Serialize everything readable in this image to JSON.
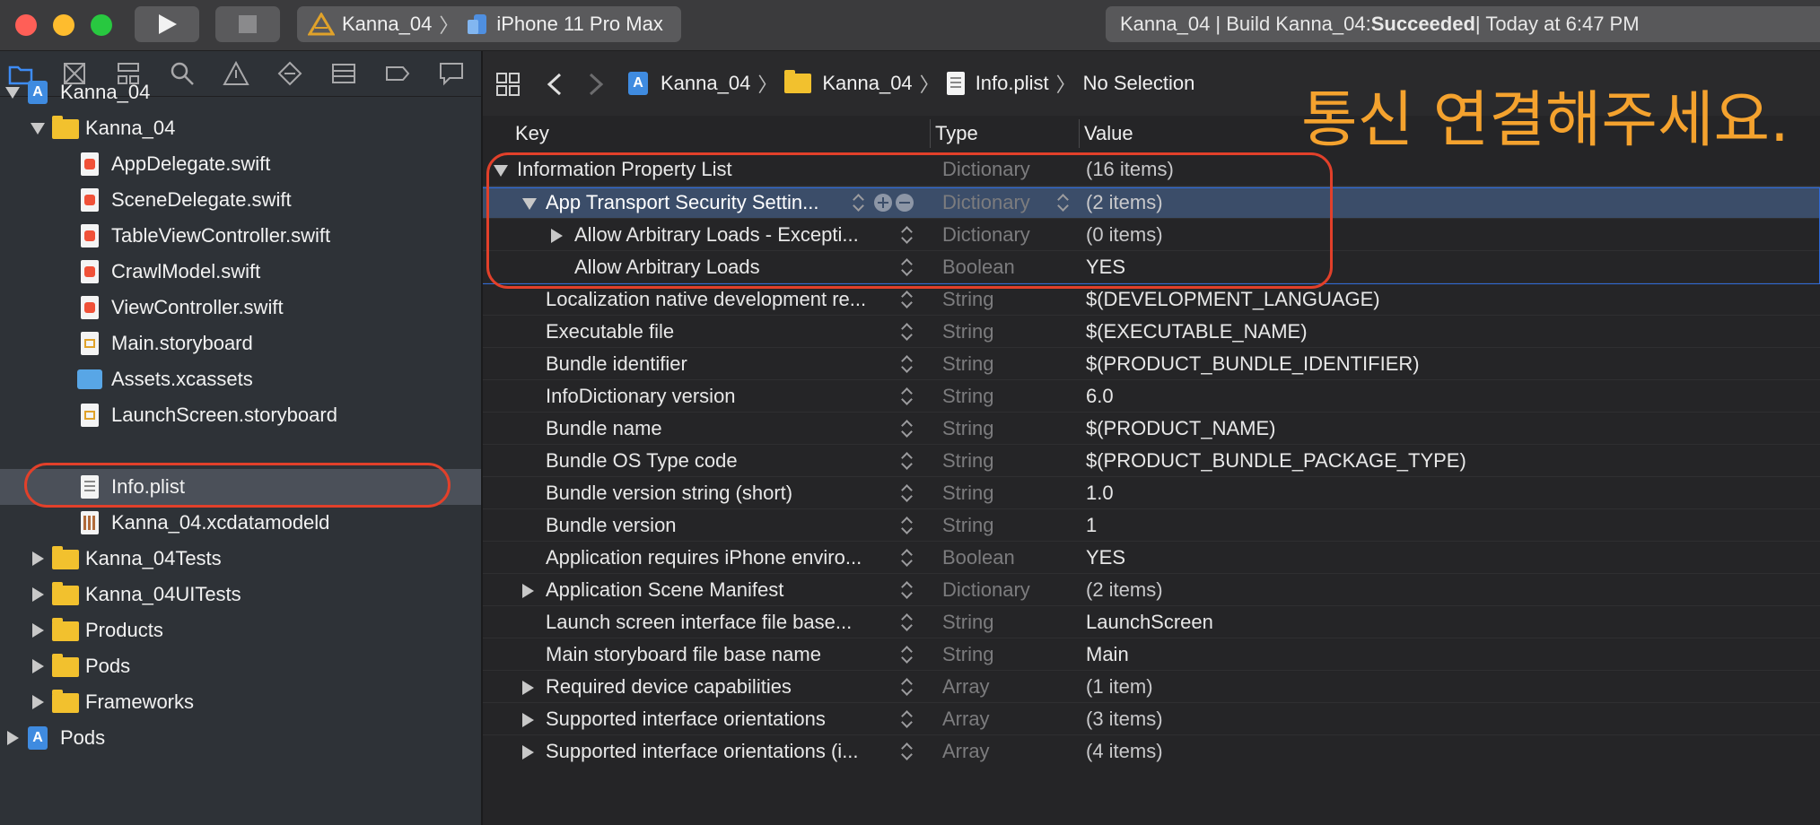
{
  "toolbar": {
    "scheme_target": "Kanna_04",
    "scheme_device": "iPhone 11 Pro Max",
    "status_prefix": "Kanna_04 | Build Kanna_04: ",
    "status_result": "Succeeded",
    "status_time": " | Today at 6:47 PM"
  },
  "navigator": {
    "items": [
      {
        "label": "Kanna_04"
      },
      {
        "label": "Kanna_04"
      },
      {
        "label": "AppDelegate.swift"
      },
      {
        "label": "SceneDelegate.swift"
      },
      {
        "label": "TableViewController.swift"
      },
      {
        "label": "CrawlModel.swift"
      },
      {
        "label": "ViewController.swift"
      },
      {
        "label": "Main.storyboard"
      },
      {
        "label": "Assets.xcassets"
      },
      {
        "label": "LaunchScreen.storyboard"
      },
      {
        "label": "Info.plist"
      },
      {
        "label": "Kanna_04.xcdatamodeld"
      },
      {
        "label": "Kanna_04Tests"
      },
      {
        "label": "Kanna_04UITests"
      },
      {
        "label": "Products"
      },
      {
        "label": "Pods"
      },
      {
        "label": "Frameworks"
      },
      {
        "label": "Pods"
      }
    ]
  },
  "jumpbar": {
    "crumb1": "Kanna_04",
    "crumb2": "Kanna_04",
    "crumb3": "Info.plist",
    "crumb4": "No Selection"
  },
  "annotation": "통신 연결해주세요.",
  "plist": {
    "col_key": "Key",
    "col_type": "Type",
    "col_value": "Value",
    "rows": [
      {
        "key": "Information Property List",
        "type": "Dictionary",
        "value": "(16 items)"
      },
      {
        "key": "App Transport Security Settin...",
        "type": "Dictionary",
        "value": "(2 items)"
      },
      {
        "key": "Allow Arbitrary Loads - Excepti...",
        "type": "Dictionary",
        "value": "(0 items)"
      },
      {
        "key": "Allow Arbitrary Loads",
        "type": "Boolean",
        "value": "YES"
      },
      {
        "key": "Localization native development re...",
        "type": "String",
        "value": "$(DEVELOPMENT_LANGUAGE)"
      },
      {
        "key": "Executable file",
        "type": "String",
        "value": "$(EXECUTABLE_NAME)"
      },
      {
        "key": "Bundle identifier",
        "type": "String",
        "value": "$(PRODUCT_BUNDLE_IDENTIFIER)"
      },
      {
        "key": "InfoDictionary version",
        "type": "String",
        "value": "6.0"
      },
      {
        "key": "Bundle name",
        "type": "String",
        "value": "$(PRODUCT_NAME)"
      },
      {
        "key": "Bundle OS Type code",
        "type": "String",
        "value": "$(PRODUCT_BUNDLE_PACKAGE_TYPE)"
      },
      {
        "key": "Bundle version string (short)",
        "type": "String",
        "value": "1.0"
      },
      {
        "key": "Bundle version",
        "type": "String",
        "value": "1"
      },
      {
        "key": "Application requires iPhone enviro...",
        "type": "Boolean",
        "value": "YES"
      },
      {
        "key": "Application Scene Manifest",
        "type": "Dictionary",
        "value": "(2 items)"
      },
      {
        "key": "Launch screen interface file base...",
        "type": "String",
        "value": "LaunchScreen"
      },
      {
        "key": "Main storyboard file base name",
        "type": "String",
        "value": "Main"
      },
      {
        "key": "Required device capabilities",
        "type": "Array",
        "value": "(1 item)"
      },
      {
        "key": "Supported interface orientations",
        "type": "Array",
        "value": "(3 items)"
      },
      {
        "key": "Supported interface orientations (i...",
        "type": "Array",
        "value": "(4 items)"
      }
    ]
  },
  "colors": {
    "annotation": "#f4a22e",
    "highlight_outline": "#e2402a",
    "selected_row": "#3b4d69"
  }
}
